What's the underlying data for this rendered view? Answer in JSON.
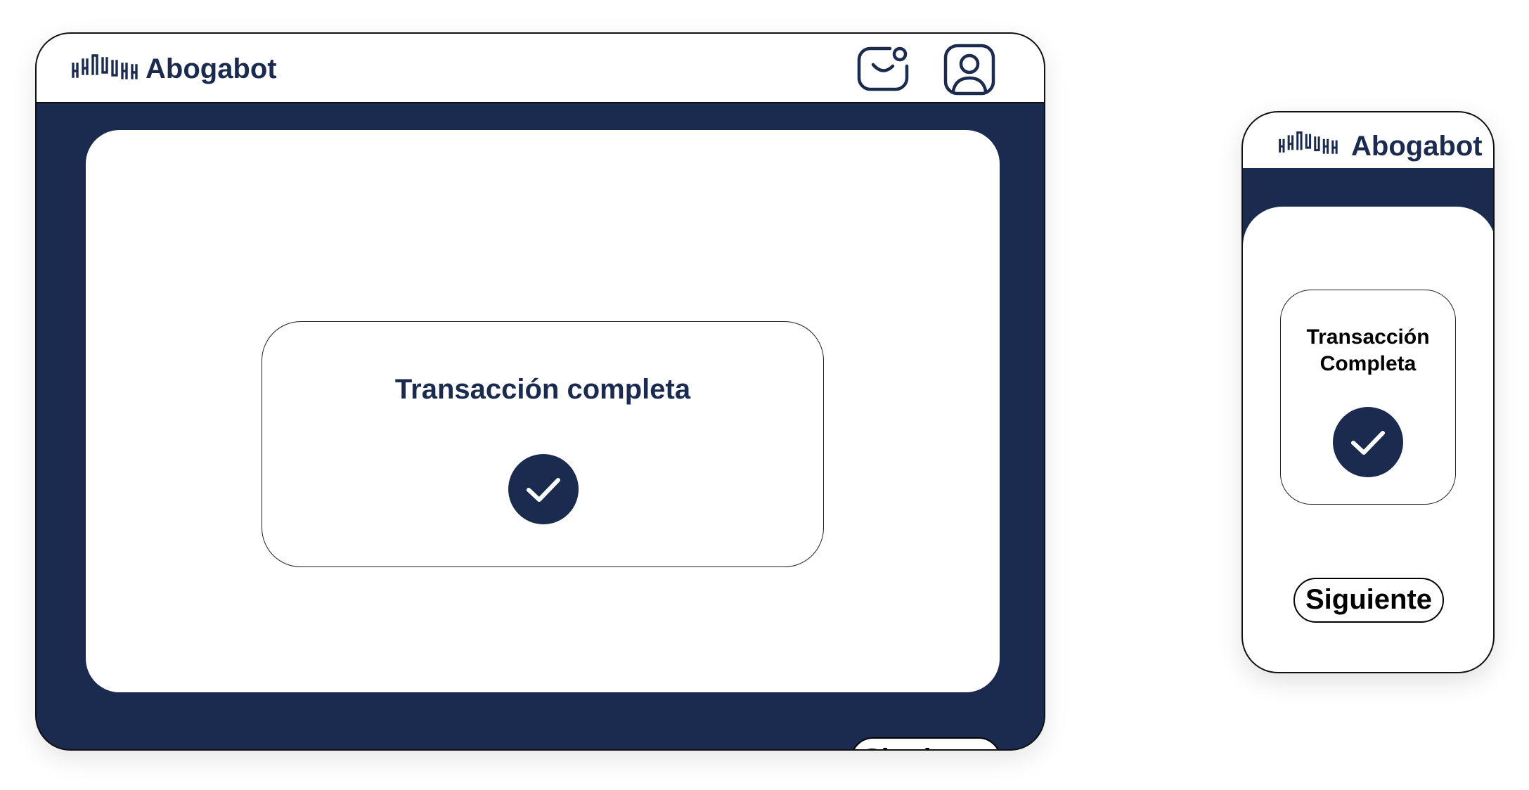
{
  "app": {
    "brand_name": "Abogabot"
  },
  "desktop": {
    "header": {
      "logo_icon": "sound-wave-logo-icon",
      "messages_icon": "mail-notification-icon",
      "profile_icon": "user-profile-icon"
    },
    "card": {
      "title": "Transacción completa",
      "status_icon": "checkmark-icon"
    },
    "next_button_label": "Siguiente"
  },
  "mobile": {
    "header": {
      "logo_icon": "sound-wave-logo-icon"
    },
    "card": {
      "title_line1": "Transacción",
      "title_line2": "Completa",
      "status_icon": "checkmark-icon"
    },
    "next_button_label": "Siguiente"
  },
  "colors": {
    "navy": "#1a2b4f",
    "white": "#ffffff",
    "border": "#111111"
  }
}
